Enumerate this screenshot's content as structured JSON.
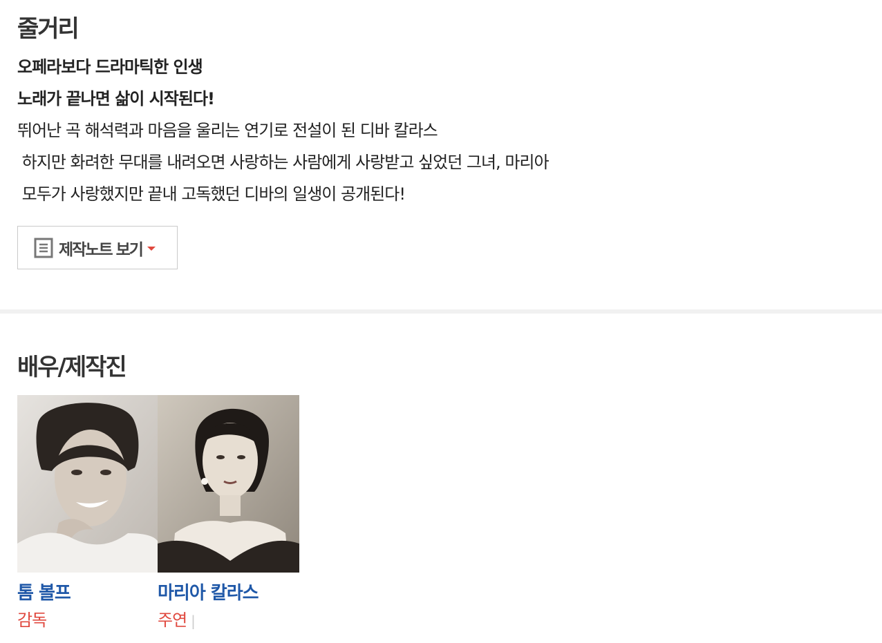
{
  "synopsis": {
    "title": "줄거리",
    "lines": [
      {
        "text": "오페라보다 드라마틱한 인생",
        "bold": true
      },
      {
        "text": "노래가 끝나면 삶이 시작된다!",
        "bold": true
      },
      {
        "text": "뛰어난 곡 해석력과 마음을 울리는 연기로 전설이 된 디바 칼라스",
        "bold": false
      },
      {
        "text": " 하지만 화려한 무대를 내려오면 사랑하는 사람에게 사랑받고 싶었던 그녀, 마리아",
        "bold": false
      },
      {
        "text": " 모두가 사랑했지만 끝내 고독했던 디바의 일생이 공개된다!",
        "bold": false
      }
    ],
    "note_button": {
      "label": "제작노트 보기",
      "icon": "document-icon",
      "caret": "caret-down-icon"
    }
  },
  "cast": {
    "title": "배우/제작진",
    "members": [
      {
        "name": "톰 볼프",
        "role": "감독",
        "separator": "",
        "photo": "man-portrait"
      },
      {
        "name": "마리아 칼라스",
        "role": "주연",
        "separator": "|",
        "photo": "woman-portrait"
      }
    ]
  },
  "colors": {
    "link": "#1f58a8",
    "accent": "#e0483e",
    "divider": "#f1f1f1"
  }
}
